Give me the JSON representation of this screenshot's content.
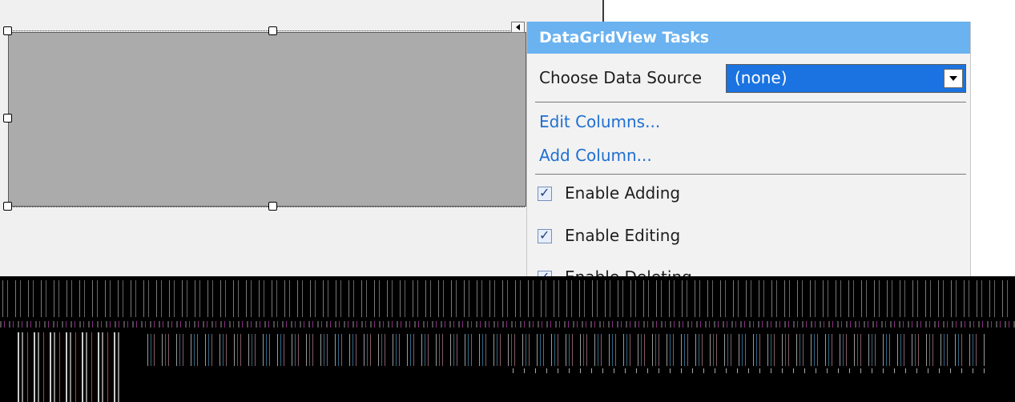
{
  "panel": {
    "title": "DataGridView Tasks",
    "choose_data_source_label": "Choose Data Source",
    "data_source_value": "(none)",
    "edit_columns_link": "Edit Columns...",
    "add_column_link": "Add Column...",
    "checkboxes": [
      {
        "label": "Enable Adding",
        "checked": true
      },
      {
        "label": "Enable Editing",
        "checked": true
      },
      {
        "label": "Enable Deleting",
        "checked": true
      }
    ]
  },
  "colors": {
    "header_bg": "#6ab2f0",
    "selected_combo_bg": "#1a73e0",
    "link_color": "#1f6fd1",
    "grid_bg": "#ababab"
  }
}
